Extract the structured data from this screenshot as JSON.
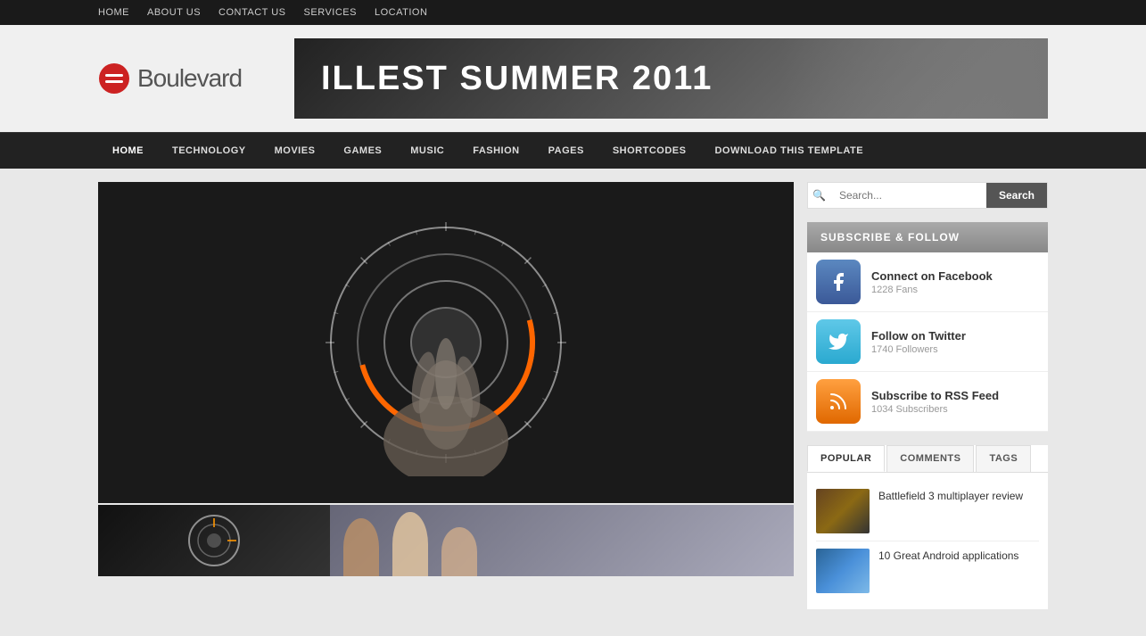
{
  "topnav": {
    "items": [
      {
        "label": "HOME",
        "href": "#"
      },
      {
        "label": "ABOUT US",
        "href": "#"
      },
      {
        "label": "CONTACT US",
        "href": "#"
      },
      {
        "label": "SERVICES",
        "href": "#"
      },
      {
        "label": "LOCATION",
        "href": "#"
      }
    ]
  },
  "header": {
    "logo_text": "Boulevard",
    "banner_text": "ILLEST SUMMER 2011"
  },
  "mainnav": {
    "items": [
      {
        "label": "HOME",
        "href": "#",
        "active": true
      },
      {
        "label": "TECHNOLOGY",
        "href": "#"
      },
      {
        "label": "MOVIES",
        "href": "#"
      },
      {
        "label": "GAMES",
        "href": "#"
      },
      {
        "label": "MUSIC",
        "href": "#"
      },
      {
        "label": "FASHION",
        "href": "#"
      },
      {
        "label": "PAGES",
        "href": "#"
      },
      {
        "label": "SHORTCODES",
        "href": "#"
      },
      {
        "label": "DOWNLOAD THIS TEMPLATE",
        "href": "#"
      }
    ]
  },
  "search": {
    "placeholder": "Search...",
    "button_label": "Search"
  },
  "subscribe": {
    "header": "SUBSCRIBE & FOLLOW",
    "items": [
      {
        "type": "facebook",
        "title": "Connect on Facebook",
        "count": "1228 Fans",
        "icon_char": "f"
      },
      {
        "type": "twitter",
        "title": "Follow on Twitter",
        "count": "1740 Followers",
        "icon_char": "t"
      },
      {
        "type": "rss",
        "title": "Subscribe to RSS Feed",
        "count": "1034 Subscribers",
        "icon_char": "r"
      }
    ]
  },
  "tabs": {
    "items": [
      {
        "label": "POPULAR",
        "active": true
      },
      {
        "label": "COMMENTS",
        "active": false
      },
      {
        "label": "TAGS",
        "active": false
      }
    ],
    "articles": [
      {
        "title": "Battlefield 3 multiplayer review",
        "thumb_type": "bf3"
      },
      {
        "title": "10 Great Android applications",
        "thumb_type": "android"
      }
    ]
  }
}
